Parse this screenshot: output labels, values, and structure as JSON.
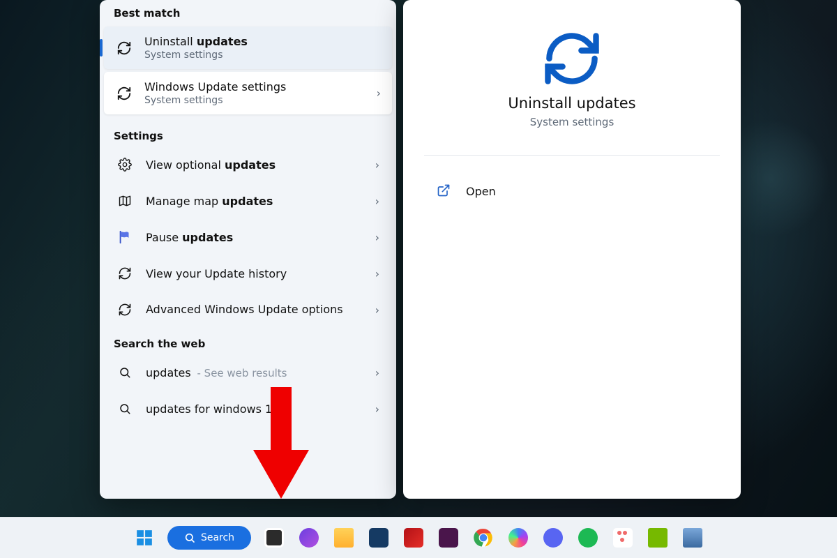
{
  "left": {
    "best_match_head": "Best match",
    "settings_head": "Settings",
    "search_web_head": "Search the web",
    "best": [
      {
        "title_pre": "Uninstall ",
        "title_bold": "updates",
        "sub": "System settings"
      },
      {
        "title_pre": "Windows Update settings",
        "title_bold": "",
        "sub": "System settings"
      }
    ],
    "settings_rows": [
      {
        "pre": "View optional ",
        "bold": "updates"
      },
      {
        "pre": "Manage map ",
        "bold": "updates"
      },
      {
        "pre": "Pause ",
        "bold": "updates"
      },
      {
        "pre": "View your Update history",
        "bold": ""
      },
      {
        "pre": "Advanced Windows Update options",
        "bold": ""
      }
    ],
    "web_rows": [
      {
        "term": "updates",
        "hint": " - See web results"
      },
      {
        "term": "updates for windows 10",
        "hint": ""
      }
    ]
  },
  "right": {
    "title": "Uninstall updates",
    "sub": "System settings",
    "actions": [
      {
        "label": "Open"
      }
    ]
  },
  "taskbar": {
    "search_label": "Search"
  },
  "glyphs": {
    "chev": "›"
  }
}
